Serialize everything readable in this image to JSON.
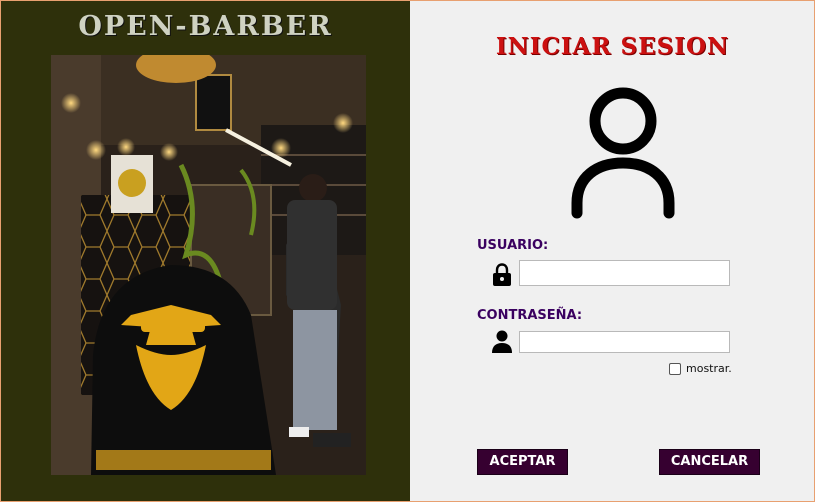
{
  "brand": {
    "title": "OPEN-BARBER"
  },
  "photo": {
    "description_icon": "barbershop-photo"
  },
  "login": {
    "title": "INICIAR SESION",
    "user_label": "USUARIO:",
    "user_value": "",
    "user_icon": "lock-icon",
    "password_label": "CONTRASEÑA:",
    "password_value": "",
    "password_icon": "person-icon",
    "show_label": "mostrar.",
    "show_checked": false,
    "accept_label": "ACEPTAR",
    "cancel_label": "CANCELAR"
  },
  "colors": {
    "left_panel": "#2e300b",
    "title": "#cc1111",
    "labels": "#3a0060",
    "buttons": "#360030"
  }
}
